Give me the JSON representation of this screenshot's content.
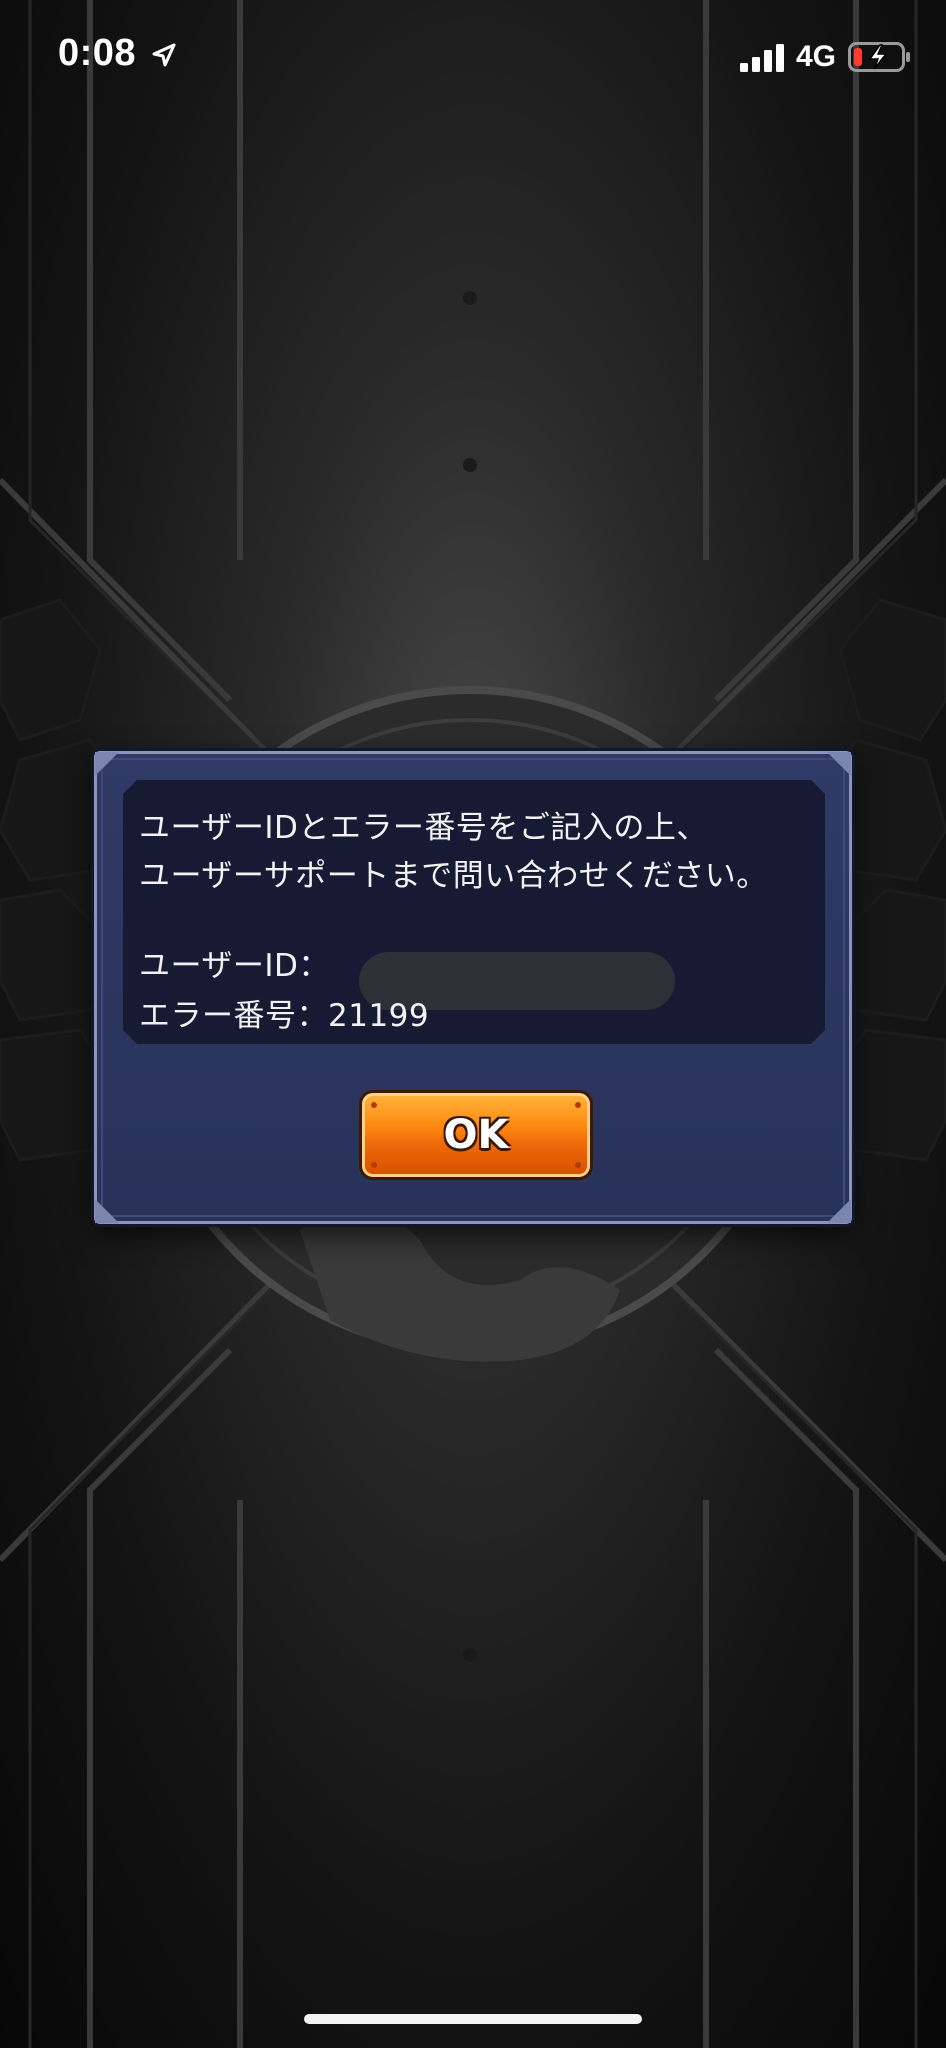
{
  "status_bar": {
    "time": "0:08",
    "network": "4G",
    "icons": [
      "location-arrow-icon",
      "signal-bars-icon",
      "battery-low-charging-icon"
    ],
    "battery_color": "#ff3b30"
  },
  "dialog": {
    "message_line1": "ユーザーIDとエラー番号をご記入の上、",
    "message_line2": "ユーザーサポートまで問い合わせください。",
    "user_id_label": "ユーザーID：",
    "error_label": "エラー番号：21199",
    "ok_button": "OK"
  },
  "colors": {
    "dialog_bg": "#2f3a66",
    "panel_bg": "#161b33",
    "button_orange": "#ff8a12"
  }
}
